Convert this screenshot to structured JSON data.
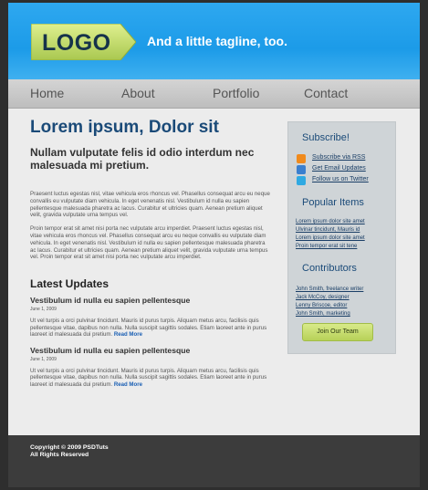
{
  "header": {
    "logo_text": "LOGO",
    "tagline": "And a little tagline, too."
  },
  "nav": {
    "items": [
      "Home",
      "About",
      "Portfolio",
      "Contact"
    ]
  },
  "main": {
    "title": "Lorem ipsum, Dolor sit",
    "subtitle": "Nullam vulputate felis id odio interdum nec malesuada mi pretium.",
    "paragraphs": [
      "Praesent luctus egestas nisl, vitae vehicula eros rhoncus vel. Phasellus consequat arcu eu neque convallis eu vulputate diam vehicula. In eget venenatis nisl. Vestibulum id nulla eu sapien pellentesque malesuada pharetra ac lacus. Curabitur et ultricies quam. Aenean pretium aliquet velit, gravida vulputate urna tempus vel.",
      "Proin tempor erat sit amet nisi porta nec vulputate arcu imperdiet. Praesent luctus egestas nisl, vitae vehicula eros rhoncus vel. Phasellus consequat arcu eu neque convallis eu vulputate diam vehicula. In eget venenatis nisl. Vestibulum id nulla eu sapien pellentesque malesuada pharetra ac lacus. Curabitur et ultricies quam. Aenean pretium aliquet velit, gravida vulputate urna tempus vel. Proin tempor erat sit amet nisi porta nec vulputate arcu imperdiet."
    ],
    "updates_heading": "Latest Updates",
    "updates": [
      {
        "title": "Vestibulum id nulla eu sapien pellentesque",
        "date": "June 1, 2009",
        "body": "Ut vel turpis a orci pulvinar tincidunt. Mauris id purus turpis. Aliquam metus arcu, facilisis quis pellentesque vitae, dapibus non nulla. Nulla suscipit sagittis sodales. Etiam laoreet ante in purus laoreet id malesuada dui pretium.",
        "read_more": "Read More"
      },
      {
        "title": "Vestibulum id nulla eu sapien pellentesque",
        "date": "June 1, 2009",
        "body": "Ut vel turpis a orci pulvinar tincidunt. Mauris id purus turpis. Aliquam metus arcu, facilisis quis pellentesque vitae, dapibus non nulla. Nulla suscipit sagittis sodales. Etiam laoreet ante in purus laoreet id malesuada dui pretium.",
        "read_more": "Read More"
      }
    ]
  },
  "sidebar": {
    "subscribe_heading": "Subscribe!",
    "subscribe_links": [
      {
        "label": "Subscribe via RSS",
        "icon": "rss-icon",
        "color": "#f08a1c"
      },
      {
        "label": "Get Email Updates",
        "icon": "email-icon",
        "color": "#3a7fcf"
      },
      {
        "label": "Follow us on Twitter",
        "icon": "twitter-icon",
        "color": "#2fa9e2"
      }
    ],
    "popular_heading": "Popular Items",
    "popular_items": [
      "Lorem ipsum dolor site amet",
      "Ulvinar tincidunt, Mauris id",
      "Lorem ipsum dolor site amet",
      "Proin tempor erat sit tene"
    ],
    "contributors_heading": "Contributors",
    "contributors": [
      "John Smith, freelance writer",
      "Jack McCoy, designer",
      "Lenny Briscoe, editor",
      "John Smith, marketing"
    ],
    "team_button": "Join Our Team"
  },
  "footer": {
    "copyright": "Copyright © 2009 PSDTuts",
    "rights": "All Rights Reserved"
  },
  "colors": {
    "header_blue": "#1c9be8",
    "logo_green": "#c4dc6c",
    "heading_blue": "#1a4a78",
    "link_blue": "#1a5fb4",
    "button_green": "#b7d158",
    "footer_gray": "#3c3c3c"
  }
}
